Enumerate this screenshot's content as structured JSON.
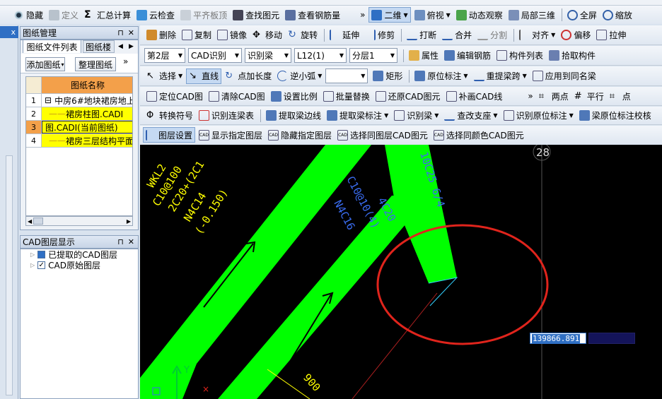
{
  "toolbar1": {
    "items": [
      {
        "label": "隐藏",
        "icon": "eye-icon"
      },
      {
        "label": "定义",
        "icon": "define-icon"
      },
      {
        "label": "汇总计算",
        "icon": "sigma-icon"
      },
      {
        "label": "云检查",
        "icon": "cloud-check-icon"
      },
      {
        "label": "平齐板顶",
        "icon": "slab-top-icon"
      },
      {
        "label": "查找图元",
        "icon": "binoculars-icon"
      },
      {
        "label": "查看钢筋量",
        "icon": "rebar-view-icon"
      }
    ],
    "view_mode": "二维",
    "view_dir": "俯视",
    "dynamic": "动态观察",
    "local3d": "局部三维",
    "fullscreen": "全屏",
    "zoom": "缩放"
  },
  "left_tab_stub": "x",
  "drawing_panel": {
    "title": "图纸管理",
    "tabs": [
      "图纸文件列表",
      "图纸楼"
    ],
    "add_btn": "添加图纸",
    "organize_btn": "整理图纸",
    "col_header": "图纸名称",
    "rows": [
      {
        "no": "1",
        "name": "中房6#地块裙房地上:",
        "prefix": "⊟"
      },
      {
        "no": "2",
        "name": "裙房柱图.CADI",
        "prefix": ""
      },
      {
        "no": "3",
        "name": "图.CADI(当前图纸)",
        "prefix": ""
      },
      {
        "no": "4",
        "name": "裙房三层结构平面",
        "prefix": ""
      }
    ]
  },
  "layer_panel": {
    "title": "CAD图层显示",
    "items": [
      "已提取的CAD图层",
      "CAD原始图层"
    ]
  },
  "toolbar2": {
    "items": [
      "删除",
      "复制",
      "镜像",
      "移动",
      "旋转",
      "延伸",
      "修剪",
      "打断",
      "合并",
      "分割",
      "对齐",
      "偏移",
      "拉伸"
    ]
  },
  "toolbar3": {
    "floor": "第2层",
    "cad_recog": "CAD识别",
    "recog_beam": "识别梁",
    "beam_name": "L12(1)",
    "layer": "分层1",
    "items": [
      "属性",
      "编辑钢筋",
      "构件列表",
      "拾取构件"
    ]
  },
  "toolbar4": {
    "items": [
      "选择",
      "直线",
      "点加长度",
      "逆小弧",
      "",
      "矩形",
      "原位标注",
      "重提梁跨",
      "应用到同名梁"
    ]
  },
  "toolbar5": {
    "items": [
      "定位CAD图",
      "清除CAD图",
      "设置比例",
      "批量替换",
      "还原CAD图元",
      "补画CAD线"
    ],
    "right": [
      "两点",
      "平行",
      "点"
    ]
  },
  "toolbar6": {
    "items": [
      "转换符号",
      "识别连梁表",
      "提取梁边线",
      "提取梁标注",
      "识别梁",
      "查改支座",
      "识别原位标注",
      "梁原位标注校核"
    ]
  },
  "toolbar7": {
    "items": [
      "图层设置",
      "显示指定图层",
      "隐藏指定图层",
      "选择同图层CAD图元",
      "选择同颜色CAD图元"
    ]
  },
  "canvas": {
    "text_yellow_1": "WKL2",
    "text_yellow_2": "C10@100",
    "text_yellow_3": "2C20+(2C1",
    "text_yellow_4": "N4C14",
    "text_yellow_5": "(-0.150)",
    "text_blue_1": "C10@10(4)",
    "text_blue_2": "4C20",
    "text_blue_3": "N4C16",
    "text_blue_4": "10C25 6/4",
    "axis_label": "28",
    "dim_label": "900",
    "coord_input": "139866.891",
    "y_axis": "Y",
    "colors": {
      "background": "#000000",
      "beam_fill": "#00ff00",
      "annotation_yellow": "#ffff00",
      "annotation_blue": "#3a6cf0",
      "highlight_circle": "#e0241c"
    }
  }
}
